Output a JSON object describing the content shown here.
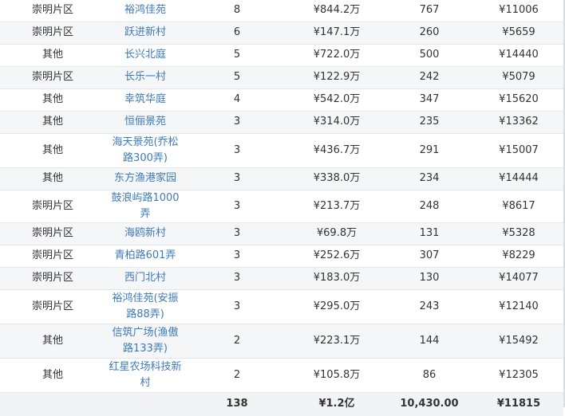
{
  "rows": [
    {
      "area": "崇明片区",
      "name": "裕鸿佳苑",
      "count": "8",
      "total": "¥844.2万",
      "size": "767",
      "price": "¥11006"
    },
    {
      "area": "崇明片区",
      "name": "跃进新村",
      "count": "6",
      "total": "¥147.1万",
      "size": "260",
      "price": "¥5659"
    },
    {
      "area": "其他",
      "name": "长兴北庭",
      "count": "5",
      "total": "¥722.0万",
      "size": "500",
      "price": "¥14440"
    },
    {
      "area": "崇明片区",
      "name": "长乐一村",
      "count": "5",
      "total": "¥122.9万",
      "size": "242",
      "price": "¥5079"
    },
    {
      "area": "其他",
      "name": "幸筑华庭",
      "count": "4",
      "total": "¥542.0万",
      "size": "347",
      "price": "¥15620"
    },
    {
      "area": "其他",
      "name": "恒俪景苑",
      "count": "3",
      "total": "¥314.0万",
      "size": "235",
      "price": "¥13362"
    },
    {
      "area": "其他",
      "name": "海天景苑(乔松路300弄)",
      "count": "3",
      "total": "¥436.7万",
      "size": "291",
      "price": "¥15007"
    },
    {
      "area": "其他",
      "name": "东方渔港家园",
      "count": "3",
      "total": "¥338.0万",
      "size": "234",
      "price": "¥14444"
    },
    {
      "area": "崇明片区",
      "name": "鼓浪屿路1000弄",
      "count": "3",
      "total": "¥213.7万",
      "size": "248",
      "price": "¥8617"
    },
    {
      "area": "崇明片区",
      "name": "海鸥新村",
      "count": "3",
      "total": "¥69.8万",
      "size": "131",
      "price": "¥5328"
    },
    {
      "area": "崇明片区",
      "name": "青柏路601弄",
      "count": "3",
      "total": "¥252.6万",
      "size": "307",
      "price": "¥8229"
    },
    {
      "area": "崇明片区",
      "name": "西门北村",
      "count": "3",
      "total": "¥183.0万",
      "size": "130",
      "price": "¥14077"
    },
    {
      "area": "崇明片区",
      "name": "裕鸿佳苑(安振路88弄)",
      "count": "3",
      "total": "¥295.0万",
      "size": "243",
      "price": "¥12140"
    },
    {
      "area": "其他",
      "name": "信筑广场(渔傲路133弄)",
      "count": "2",
      "total": "¥223.1万",
      "size": "144",
      "price": "¥15492"
    },
    {
      "area": "其他",
      "name": "红星农场科技新村",
      "count": "2",
      "total": "¥105.8万",
      "size": "86",
      "price": "¥12305"
    }
  ],
  "summary": {
    "area": "",
    "name": "",
    "count": "138",
    "total": "¥1.2亿",
    "size": "10,430.00",
    "price": "¥11815"
  }
}
